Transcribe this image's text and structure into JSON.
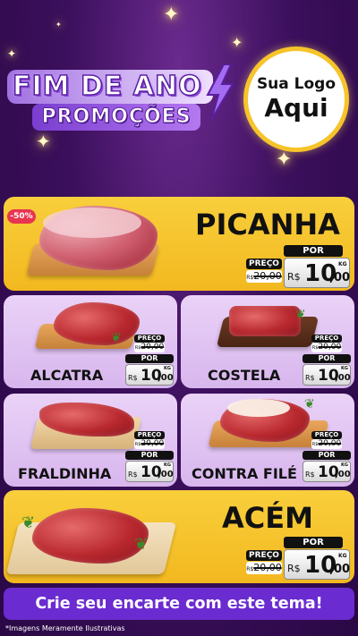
{
  "header": {
    "title_line1": "FIM DE ANO",
    "title_line2": "PROMOÇÕES",
    "logo_line1": "Sua Logo",
    "logo_line2": "Aqui"
  },
  "products": [
    {
      "name": "PICANHA",
      "discount": "-50%",
      "preco_label": "PREÇO",
      "old_price": "20,00",
      "old_prefix": "R$",
      "por_label": "POR",
      "currency": "R$",
      "price_int": "10",
      "price_dec": ",00",
      "unit": "KG"
    },
    {
      "name": "ALCATRA",
      "preco_label": "PREÇO",
      "old_price": "20,00",
      "old_prefix": "R$",
      "por_label": "POR",
      "currency": "R$",
      "price_int": "10",
      "price_dec": ",00",
      "unit": "KG"
    },
    {
      "name": "COSTELA",
      "preco_label": "PREÇO",
      "old_price": "20,00",
      "old_prefix": "R$",
      "por_label": "POR",
      "currency": "R$",
      "price_int": "10",
      "price_dec": ",00",
      "unit": "KG"
    },
    {
      "name": "FRALDINHA",
      "preco_label": "PREÇO",
      "old_price": "20,00",
      "old_prefix": "R$",
      "por_label": "POR",
      "currency": "R$",
      "price_int": "10",
      "price_dec": ",00",
      "unit": "KG"
    },
    {
      "name": "CONTRA FILÉ",
      "preco_label": "PREÇO",
      "old_price": "20,00",
      "old_prefix": "R$",
      "por_label": "POR",
      "currency": "R$",
      "price_int": "10",
      "price_dec": ",00",
      "unit": "KG"
    },
    {
      "name": "ACÉM",
      "preco_label": "PREÇO",
      "old_price": "20,00",
      "old_prefix": "R$",
      "por_label": "POR",
      "currency": "R$",
      "price_int": "10",
      "price_dec": ",00",
      "unit": "KG"
    }
  ],
  "cta": {
    "label": "Crie seu encarte com este tema!"
  },
  "footnote": "*Imagens Meramente Ilustrativas",
  "colors": {
    "card_yellow": "#f6c42a",
    "card_purple": "#e2c4f3",
    "cta_purple": "#6a2bd0",
    "background": "#3b0f5c"
  }
}
